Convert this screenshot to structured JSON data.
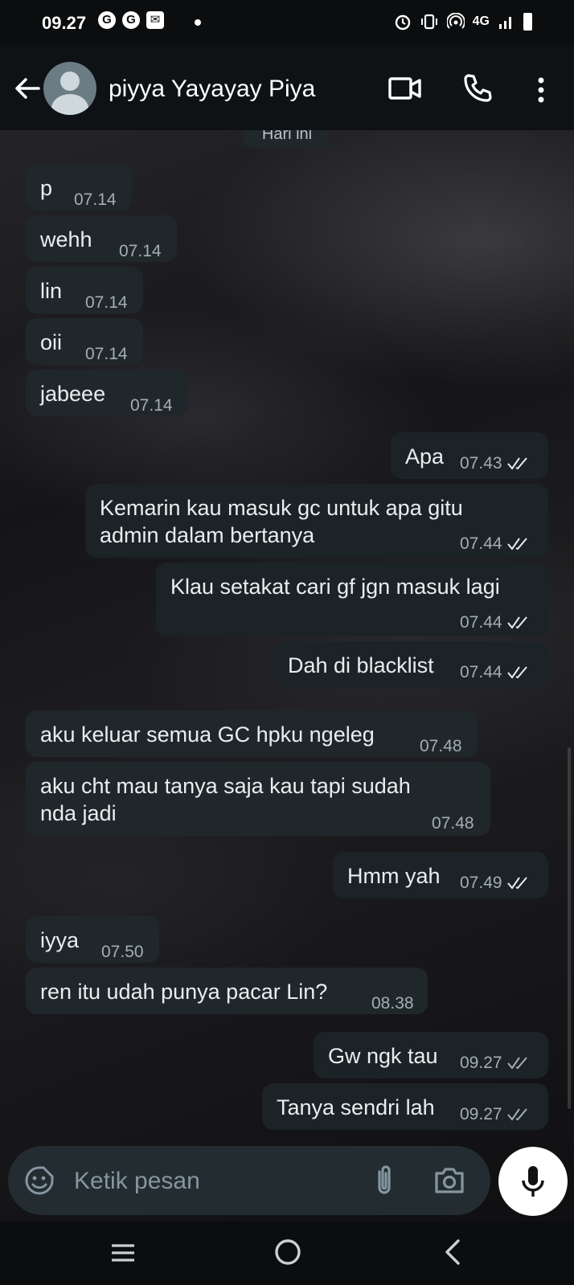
{
  "status_bar": {
    "time": "09.27",
    "network": "4G"
  },
  "header": {
    "contact_name": "piyya Yayayay Piya"
  },
  "chat": {
    "date_chip": "Hari ini",
    "messages": [
      {
        "text": "p",
        "time": "07.14",
        "direction": "incoming"
      },
      {
        "text": "wehh",
        "time": "07.14",
        "direction": "incoming"
      },
      {
        "text": "lin",
        "time": "07.14",
        "direction": "incoming"
      },
      {
        "text": "oii",
        "time": "07.14",
        "direction": "incoming"
      },
      {
        "text": "jabeee",
        "time": "07.14",
        "direction": "incoming"
      },
      {
        "text": "Apa",
        "time": "07.43",
        "direction": "outgoing",
        "status": "read"
      },
      {
        "text_line1": "Kemarin kau masuk gc untuk apa gitu",
        "text_line2": "admin dalam bertanya",
        "time": "07.44",
        "direction": "outgoing",
        "status": "read"
      },
      {
        "text": "Klau setakat cari gf jgn masuk lagi",
        "time": "07.44",
        "direction": "outgoing",
        "status": "read"
      },
      {
        "text": "Dah di blacklist",
        "time": "07.44",
        "direction": "outgoing",
        "status": "read"
      },
      {
        "text": "aku keluar semua GC hpku ngeleg",
        "time": "07.48",
        "direction": "incoming"
      },
      {
        "text_line1": "aku cht mau tanya saja kau tapi sudah",
        "text_line2": "nda jadi",
        "time": "07.48",
        "direction": "incoming"
      },
      {
        "text": "Hmm yah",
        "time": "07.49",
        "direction": "outgoing",
        "status": "read"
      },
      {
        "text": "iyya",
        "time": "07.50",
        "direction": "incoming"
      },
      {
        "text": "ren itu udah punya pacar Lin?",
        "time": "08.38",
        "direction": "incoming"
      },
      {
        "text": "Gw ngk tau",
        "time": "09.27",
        "direction": "outgoing",
        "status": "delivered"
      },
      {
        "text": "Tanya sendri lah",
        "time": "09.27",
        "direction": "outgoing",
        "status": "delivered"
      }
    ]
  },
  "composer": {
    "placeholder": "Ketik pesan"
  },
  "colors": {
    "bubble": "#20272b",
    "tick_read": "#e9edef",
    "tick_delivered": "#a3aeb4"
  }
}
